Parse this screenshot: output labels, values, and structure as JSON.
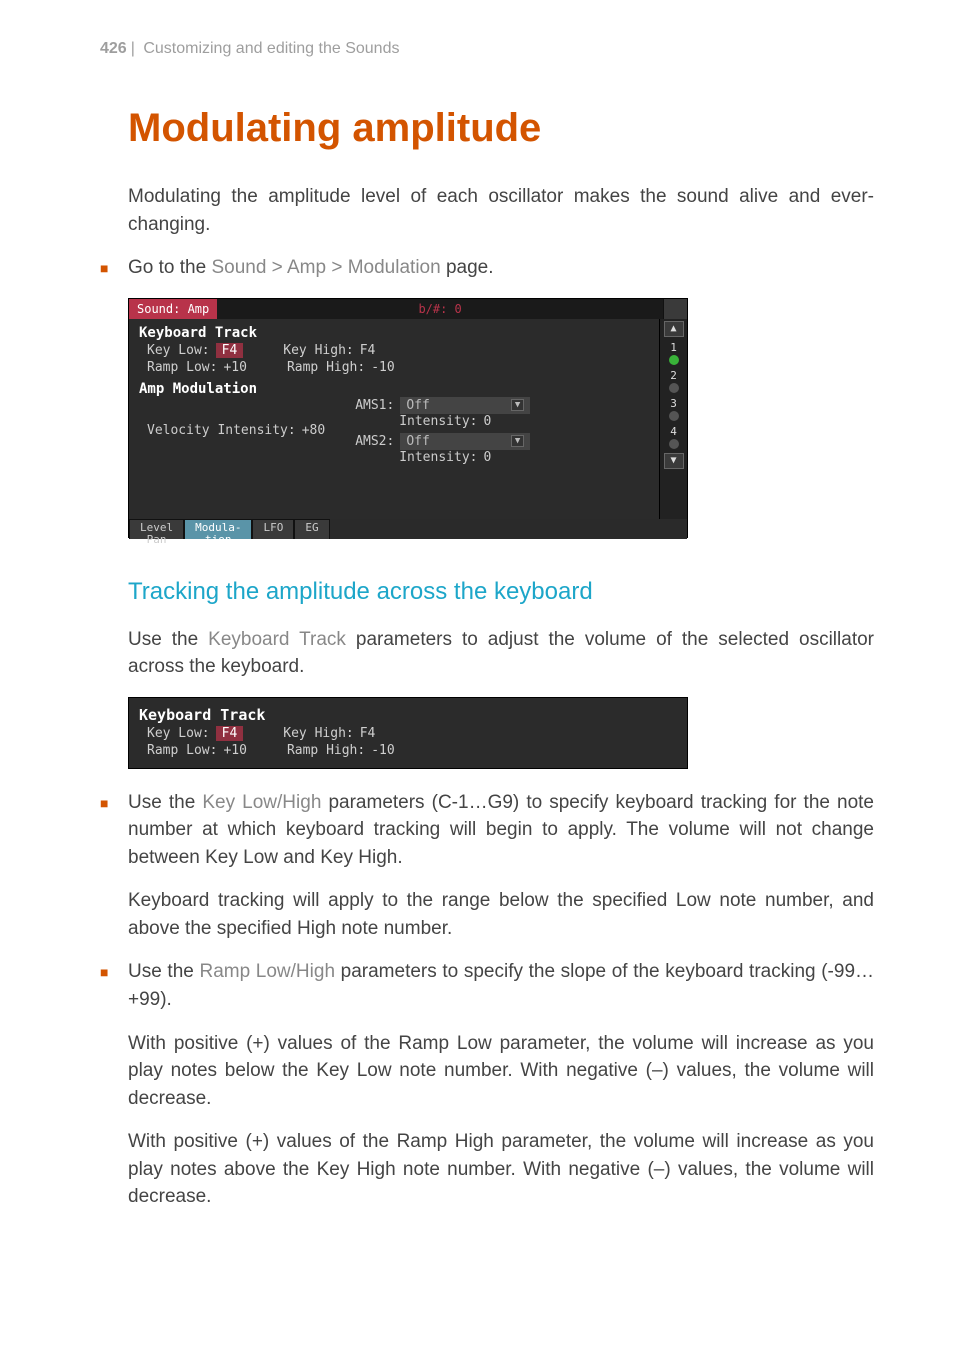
{
  "header": {
    "page_number": "426",
    "sep": "|",
    "chapter": "Customizing and editing the Sounds"
  },
  "h1": "Modulating amplitude",
  "intro": "Modulating the amplitude level of each oscillator makes the sound alive and ever-changing.",
  "bullet1_pre": "Go to the ",
  "bullet1_path": "Sound > Amp > Modulation",
  "bullet1_post": " page.",
  "ui": {
    "title_left": "Sound: Amp",
    "title_mid": "b/#: 0",
    "keyboard_track": {
      "title": "Keyboard Track",
      "key_low_label": "Key Low:",
      "key_low_value": "F4",
      "key_high_label": "Key High:",
      "key_high_value": "F4",
      "ramp_low_label": "Ramp Low:",
      "ramp_low_value": "+10",
      "ramp_high_label": "Ramp High:",
      "ramp_high_value": "-10"
    },
    "amp_mod": {
      "title": "Amp Modulation",
      "vel_label": "Velocity Intensity:",
      "vel_value": "+80",
      "ams1_label": "AMS1:",
      "ams1_value": "Off",
      "ams1_int_label": "Intensity:",
      "ams1_int_value": "0",
      "ams2_label": "AMS2:",
      "ams2_value": "Off",
      "ams2_int_label": "Intensity:",
      "ams2_int_value": "0"
    },
    "tabs": {
      "level_pan": "Level\nPan",
      "modulation": "Modula-\ntion",
      "lfo": "LFO",
      "eg": "EG"
    },
    "osc": {
      "n1": "1",
      "n2": "2",
      "n3": "3",
      "n4": "4"
    }
  },
  "h2": "Tracking the amplitude across the keyboard",
  "tracking_intro_pre": "Use the ",
  "tracking_intro_param": "Keyboard Track",
  "tracking_intro_post": " parameters to adjust the volume of the selected oscillator across the keyboard.",
  "bullet2_pre": "Use the ",
  "bullet2_param": "Key Low/High",
  "bullet2_post": " parameters (C-1…G9) to specify keyboard tracking for the note number at which keyboard tracking will begin to apply. The volume will not change between Key Low and Key High.",
  "bullet2_extra": "Keyboard tracking will apply to the range below the specified Low note number, and above the specified High note number.",
  "bullet3_pre": "Use the ",
  "bullet3_param": "Ramp Low/High",
  "bullet3_post": " parameters to specify the slope of the keyboard tracking (-99…+99).",
  "bullet3_extra1": "With positive (+) values of the Ramp Low parameter, the volume will increase as you play notes below the Key Low note number. With negative (–) values, the volume will decrease.",
  "bullet3_extra2": "With positive (+) values of the Ramp High parameter, the volume will increase as you play notes above the Key High note number. With negative (–) values, the volume will decrease."
}
